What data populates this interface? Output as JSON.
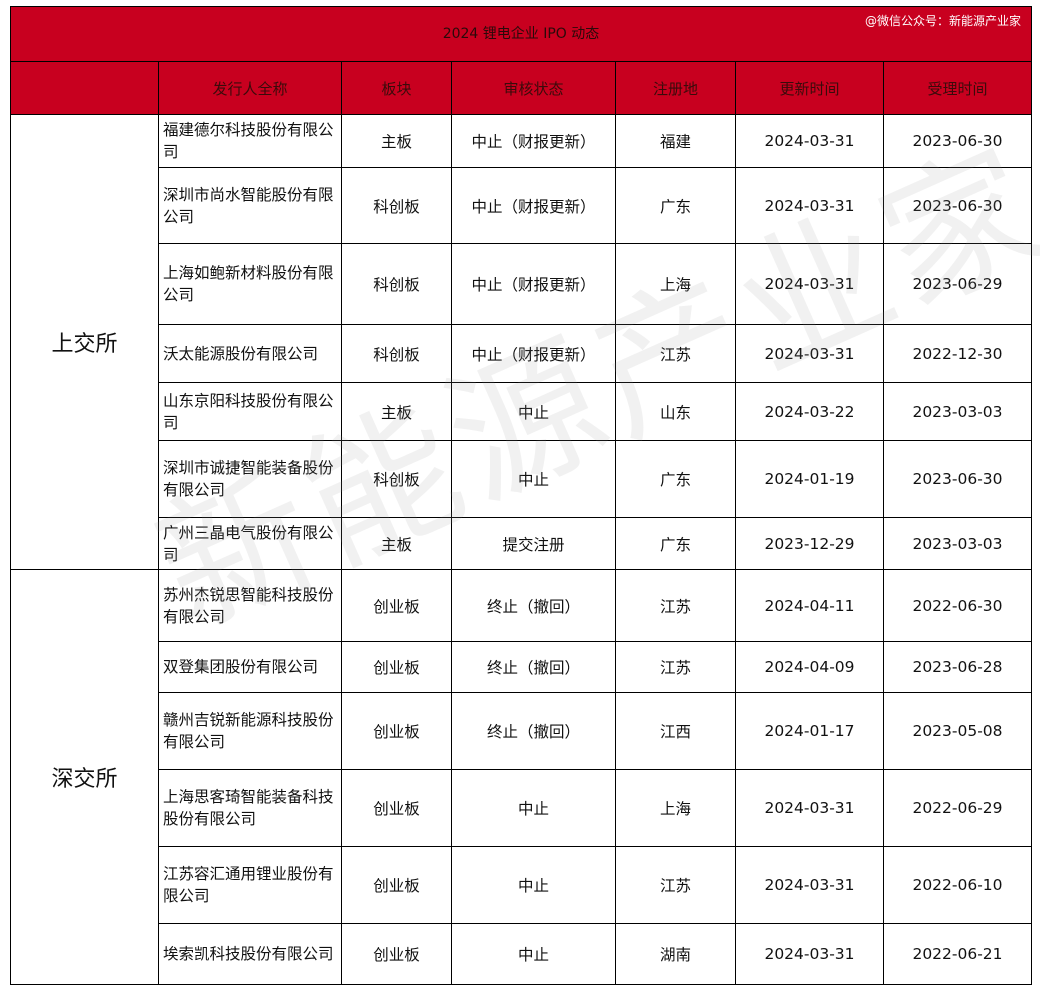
{
  "title": "2024 锂电企业 IPO 动态",
  "credit": "@微信公众号：新能源产业家",
  "headers": {
    "issuer": "发行人全称",
    "board": "板块",
    "status": "审核状态",
    "location": "注册地",
    "updated": "更新时间",
    "accepted": "受理时间"
  },
  "watermark": "新能源产业家",
  "groups": [
    {
      "exchange": "上交所",
      "rows": [
        {
          "issuer": "福建德尔科技股份有限公司",
          "board": "主板",
          "status": "中止（财报更新）",
          "location": "福建",
          "updated": "2024-03-31",
          "accepted": "2023-06-30"
        },
        {
          "issuer": "深圳市尚水智能股份有限公司",
          "board": "科创板",
          "status": "中止（财报更新）",
          "location": "广东",
          "updated": "2024-03-31",
          "accepted": "2023-06-30"
        },
        {
          "issuer": "上海如鲍新材料股份有限公司",
          "board": "科创板",
          "status": "中止（财报更新）",
          "location": "上海",
          "updated": "2024-03-31",
          "accepted": "2023-06-29"
        },
        {
          "issuer": "沃太能源股份有限公司",
          "board": "科创板",
          "status": "中止（财报更新）",
          "location": "江苏",
          "updated": "2024-03-31",
          "accepted": "2022-12-30"
        },
        {
          "issuer": "山东京阳科技股份有限公司",
          "board": "主板",
          "status": "中止",
          "location": "山东",
          "updated": "2024-03-22",
          "accepted": "2023-03-03"
        },
        {
          "issuer": "深圳市诚捷智能装备股份有限公司",
          "board": "科创板",
          "status": "中止",
          "location": "广东",
          "updated": "2024-01-19",
          "accepted": "2023-06-30"
        },
        {
          "issuer": "广州三晶电气股份有限公司",
          "board": "主板",
          "status": "提交注册",
          "location": "广东",
          "updated": "2023-12-29",
          "accepted": "2023-03-03"
        }
      ]
    },
    {
      "exchange": "深交所",
      "rows": [
        {
          "issuer": "苏州杰锐思智能科技股份有限公司",
          "board": "创业板",
          "status": "终止（撤回）",
          "location": "江苏",
          "updated": "2024-04-11",
          "accepted": "2022-06-30"
        },
        {
          "issuer": "双登集团股份有限公司",
          "board": "创业板",
          "status": "终止（撤回）",
          "location": "江苏",
          "updated": "2024-04-09",
          "accepted": "2023-06-28"
        },
        {
          "issuer": "赣州吉锐新能源科技股份有限公司",
          "board": "创业板",
          "status": "终止（撤回）",
          "location": "江西",
          "updated": "2024-01-17",
          "accepted": "2023-05-08"
        },
        {
          "issuer": "上海思客琦智能装备科技股份有限公司",
          "board": "创业板",
          "status": "中止",
          "location": "上海",
          "updated": "2024-03-31",
          "accepted": "2022-06-29"
        },
        {
          "issuer": "江苏容汇通用锂业股份有限公司",
          "board": "创业板",
          "status": "中止",
          "location": "江苏",
          "updated": "2024-03-31",
          "accepted": "2022-06-10"
        },
        {
          "issuer": "埃索凯科技股份有限公司",
          "board": "创业板",
          "status": "中止",
          "location": "湖南",
          "updated": "2024-03-31",
          "accepted": "2022-06-21"
        }
      ]
    }
  ]
}
